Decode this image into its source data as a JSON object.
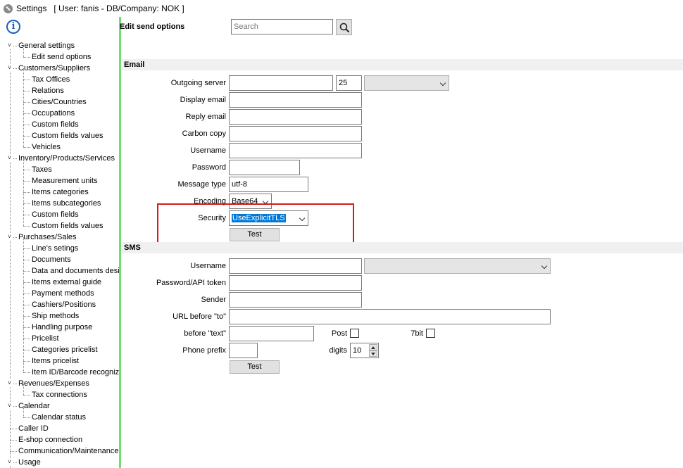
{
  "window": {
    "title": "Settings",
    "context": "[ User: fanis - DB/Company: NOK ]"
  },
  "tree": [
    {
      "label": "General settings",
      "level": 0,
      "expanded": true
    },
    {
      "label": "Edit send options",
      "level": 1
    },
    {
      "label": "Customers/Suppliers",
      "level": 0,
      "expanded": true
    },
    {
      "label": "Tax Offices",
      "level": 1
    },
    {
      "label": "Relations",
      "level": 1
    },
    {
      "label": "Cities/Countries",
      "level": 1
    },
    {
      "label": "Occupations",
      "level": 1
    },
    {
      "label": "Custom fields",
      "level": 1
    },
    {
      "label": "Custom fields values",
      "level": 1
    },
    {
      "label": "Vehicles",
      "level": 1
    },
    {
      "label": "Inventory/Products/Services",
      "level": 0,
      "expanded": true
    },
    {
      "label": "Taxes",
      "level": 1
    },
    {
      "label": "Measurement units",
      "level": 1
    },
    {
      "label": "Items categories",
      "level": 1
    },
    {
      "label": "Items subcategories",
      "level": 1
    },
    {
      "label": "Custom fields",
      "level": 1
    },
    {
      "label": "Custom fields values",
      "level": 1
    },
    {
      "label": "Purchases/Sales",
      "level": 0,
      "expanded": true
    },
    {
      "label": "Line's setings",
      "level": 1
    },
    {
      "label": "Documents",
      "level": 1
    },
    {
      "label": "Data and documents desi",
      "level": 1
    },
    {
      "label": "Items external guide",
      "level": 1
    },
    {
      "label": "Payment methods",
      "level": 1
    },
    {
      "label": "Cashiers/Positions",
      "level": 1
    },
    {
      "label": "Ship methods",
      "level": 1
    },
    {
      "label": "Handling purpose",
      "level": 1
    },
    {
      "label": "Pricelist",
      "level": 1
    },
    {
      "label": "Categories pricelist",
      "level": 1
    },
    {
      "label": "Items pricelist",
      "level": 1
    },
    {
      "label": "Item ID/Barcode recognize",
      "level": 1
    },
    {
      "label": "Revenues/Expenses",
      "level": 0,
      "expanded": true
    },
    {
      "label": "Tax connections",
      "level": 1
    },
    {
      "label": "Calendar",
      "level": 0,
      "expanded": true
    },
    {
      "label": "Calendar status",
      "level": 1
    },
    {
      "label": "Caller ID",
      "level": 0
    },
    {
      "label": "E-shop connection",
      "level": 0
    },
    {
      "label": "Communication/Maintenance",
      "level": 0
    },
    {
      "label": "Usage",
      "level": 0,
      "expanded": true
    }
  ],
  "header": {
    "title": "Edit send options",
    "search_placeholder": "Search"
  },
  "email": {
    "section_title": "Email",
    "outgoing_server_label": "Outgoing server",
    "outgoing_server_value": "",
    "port_value": "25",
    "server_type_value": "",
    "display_email_label": "Display email",
    "reply_email_label": "Reply email",
    "carbon_copy_label": "Carbon copy",
    "username_label": "Username",
    "password_label": "Password",
    "message_type_label": "Message type",
    "message_type_value": "utf-8",
    "encoding_label": "Encoding",
    "encoding_value": "Base64",
    "security_label": "Security",
    "security_value": "UseExplicitTLS",
    "test_label": "Test"
  },
  "sms": {
    "section_title": "SMS",
    "username_label": "Username",
    "password_label": "Password/API token",
    "sender_label": "Sender",
    "url_before_to_label": "URL before \"to\"",
    "before_text_label": "before \"text\"",
    "post_label": "Post",
    "bit7_label": "7bit",
    "phone_prefix_label": "Phone prefix",
    "digits_label": "digits",
    "digits_value": "10",
    "test_label": "Test"
  },
  "colors": {
    "highlight": "#d41a1a",
    "panel_border": "#6ee06e",
    "selection": "#0078d7"
  }
}
